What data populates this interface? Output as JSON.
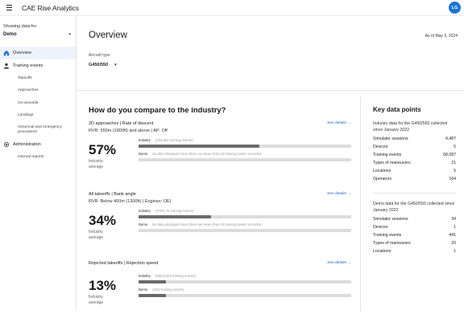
{
  "app": {
    "title": "CAE Rise Analytics",
    "user_initials": "LG"
  },
  "sidebar": {
    "showing_label": "Showing data for",
    "selected": "Demo",
    "items": [
      {
        "label": "Overview",
        "icon": "home-icon",
        "active": true
      },
      {
        "label": "Training events",
        "icon": "person-icon",
        "active": false
      },
      {
        "label": "Administration",
        "icon": "gear-icon",
        "active": false
      }
    ],
    "training_sub": [
      "Takeoffs",
      "Approaches",
      "Go-arounds",
      "Landings",
      "Abnormal and emergency procedures"
    ],
    "admin_sub": [
      "Internal reports"
    ]
  },
  "header": {
    "title": "Overview",
    "as_of": "As of May 3, 2024",
    "aircraft_label": "Aircraft type",
    "aircraft_value": "G450/550"
  },
  "compare": {
    "title": "How do you compare to the industry?",
    "see_details": "See details →",
    "industry_label": "Industry",
    "demo_label": "Demo",
    "pct_label_line1": "Industry",
    "pct_label_line2": "average",
    "metrics": [
      {
        "title": "2D approaches | Rate of descent",
        "subtitle": "RVR: 550m (1800ft) and above | AP: Off",
        "percent": "57%",
        "industry_note": "(265/464 training events)",
        "industry_fill": 0.57,
        "demo_note": "No data displayed since there are fewer than 10 training events recorded."
      },
      {
        "title": "All takeoffs | Bank angle",
        "subtitle": "RVR: Below 400m (1300ft) | Engines: OEI",
        "percent": "34%",
        "industry_note": "(570/1.7k training events)",
        "industry_fill": 0.34,
        "demo_note": "No data displayed since there are fewer than 10 training events recorded."
      },
      {
        "title": "Rejected takeoffs | Rejection speed",
        "subtitle": "",
        "percent": "13%",
        "industry_note": "(562/4,304 training events)",
        "industry_fill": 0.13,
        "demo_note": "(3/24 training events)",
        "demo_fill": 0.13
      }
    ]
  },
  "key_data": {
    "title": "Key data points",
    "industry_heading": "Industry data for the G450/550 collected since January 2022",
    "industry_rows": [
      {
        "label": "Simulator sessions",
        "value": "4,487"
      },
      {
        "label": "Devices",
        "value": "5"
      },
      {
        "label": "Training events",
        "value": "68,087"
      },
      {
        "label": "Types of maneuvers",
        "value": "21"
      },
      {
        "label": "Locations",
        "value": "5"
      },
      {
        "label": "Operators",
        "value": "164"
      }
    ],
    "demo_heading": "Demo data for the G450/550 collected since January 2022",
    "demo_rows": [
      {
        "label": "Simulator sessions",
        "value": "34"
      },
      {
        "label": "Devices",
        "value": "1"
      },
      {
        "label": "Training events",
        "value": "441"
      },
      {
        "label": "Types of maneuvers",
        "value": "20"
      },
      {
        "label": "Locations",
        "value": "1"
      }
    ]
  },
  "colors": {
    "accent": "#1976d2",
    "link": "#1565c0",
    "active_nav_bg": "#eef3fb",
    "bar_fill": "#6a6a6a",
    "bar_track": "#dcdcdc"
  }
}
